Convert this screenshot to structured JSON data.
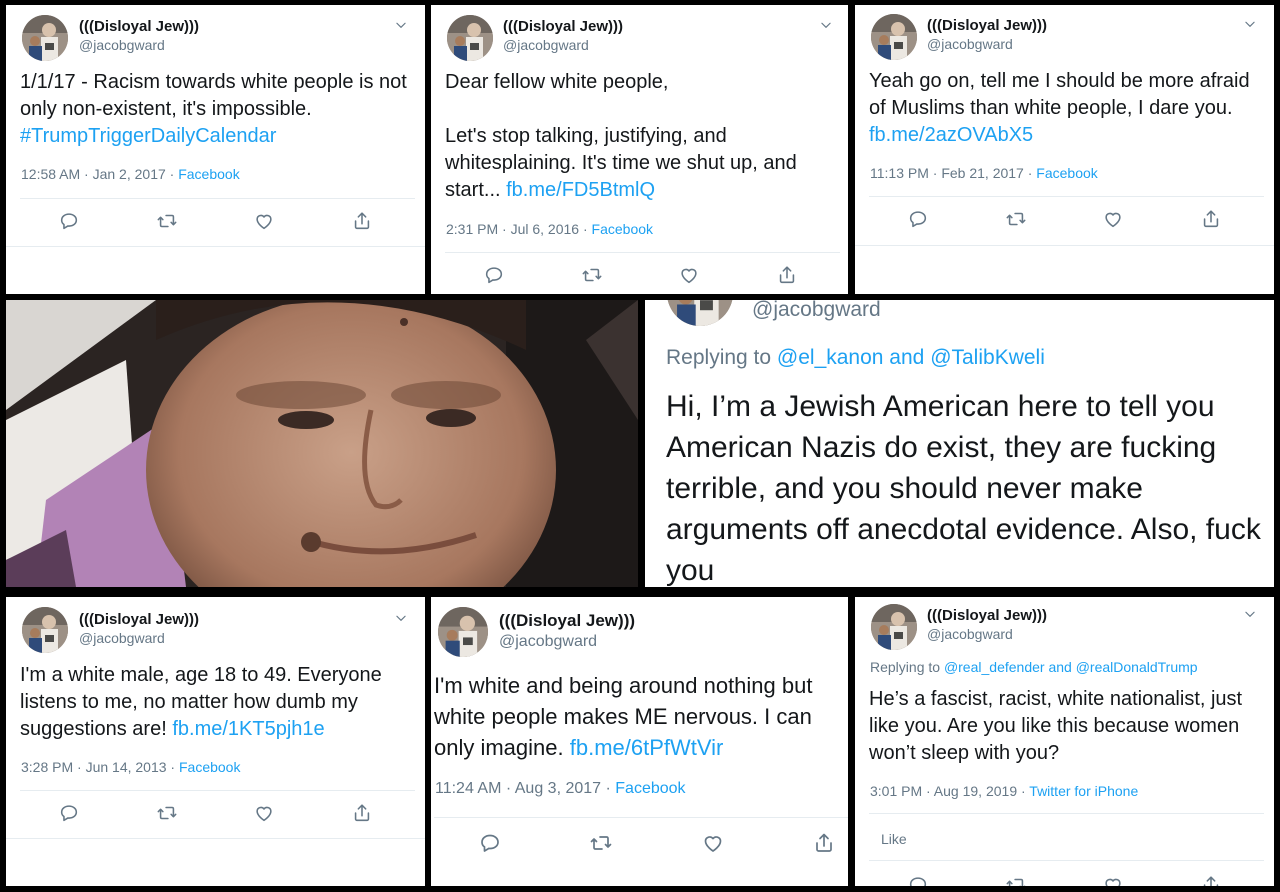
{
  "tweets": [
    {
      "display_name": "(((Disloyal Jew)))",
      "handle": "@jacobgward",
      "text": "1/1/17 - Racism towards white people is not only non-existent, it's impossible. ",
      "link": "#TrumpTriggerDailyCalendar",
      "time": "12:58 AM · Jan 2, 2017 · ",
      "source": "Facebook"
    },
    {
      "display_name": "(((Disloyal Jew)))",
      "handle": "@jacobgward",
      "text_line1": "Dear fellow white people,",
      "text": "Let's stop talking, justifying, and whitesplaining. It's time we shut up, and start... ",
      "link": "fb.me/FD5BtmlQ",
      "time": "2:31 PM · Jul 6, 2016 · ",
      "source": "Facebook"
    },
    {
      "display_name": "(((Disloyal Jew)))",
      "handle": "@jacobgward",
      "text": "Yeah go on, tell me I should be more afraid of Muslims than white people, I dare you. ",
      "link": "fb.me/2azOVAbX5",
      "time": "11:13 PM · Feb 21, 2017 · ",
      "source": "Facebook"
    },
    {
      "handle": "@jacobgward",
      "replying_prefix": "Replying to ",
      "replying_user1": "@el_kanon",
      "replying_and": " and ",
      "replying_user2": "@TalibKweli",
      "text": "Hi, I’m a Jewish American here to tell you American Nazis do exist, they are fucking terrible, and you should never make arguments off anecdotal evidence. Also, fuck you"
    },
    {
      "display_name": "(((Disloyal Jew)))",
      "handle": "@jacobgward",
      "text": "I'm a white male, age 18 to 49.  Everyone listens to me, no matter how dumb my suggestions are! ",
      "link": "fb.me/1KT5pjh1e",
      "time": "3:28 PM · Jun 14, 2013 · ",
      "source": "Facebook"
    },
    {
      "display_name": "(((Disloyal Jew)))",
      "handle": "@jacobgward",
      "text": "I'm white and being around nothing but white people makes ME nervous. I can only imagine. ",
      "link": "fb.me/6tPfWtVir",
      "time": "11:24 AM · Aug 3, 2017 · ",
      "source": "Facebook"
    },
    {
      "display_name": "(((Disloyal Jew)))",
      "handle": "@jacobgward",
      "replying_prefix": "Replying to ",
      "replying_user1": "@real_defender",
      "replying_and": " and ",
      "replying_user2": "@realDonaldTrump",
      "text": "He’s a fascist, racist, white nationalist, just like you. Are you like this because women won’t sleep with you?",
      "time": "3:01 PM · Aug 19, 2019 · ",
      "source": "Twitter for iPhone",
      "like_label": "Like"
    }
  ],
  "icons": [
    "reply-icon",
    "retweet-icon",
    "like-icon",
    "share-icon",
    "chevron-down-icon"
  ],
  "colors": {
    "link": "#1da1f2",
    "muted": "#657786",
    "text": "#14171a",
    "border": "#000000"
  }
}
